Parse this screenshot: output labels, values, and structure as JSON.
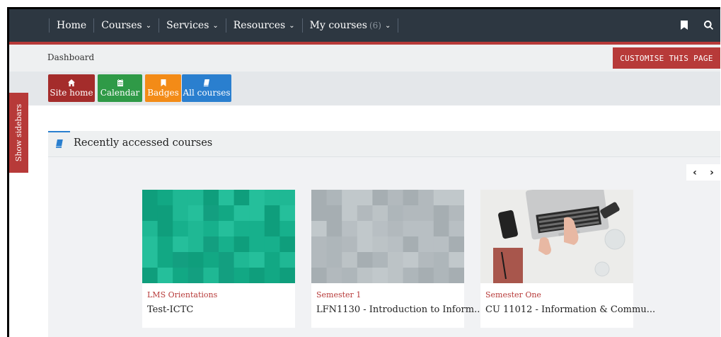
{
  "navbar": {
    "items": [
      {
        "label": "Home",
        "dropdown": false
      },
      {
        "label": "Courses",
        "dropdown": true
      },
      {
        "label": "Services",
        "dropdown": true
      },
      {
        "label": "Resources",
        "dropdown": true
      },
      {
        "label": "My courses",
        "count": "(6)",
        "dropdown": true
      }
    ],
    "right_icons": [
      "bookmark-icon",
      "search-icon"
    ]
  },
  "header": {
    "breadcrumb": "Dashboard",
    "customise_label": "CUSTOMISE THIS PAGE"
  },
  "quick_links": [
    {
      "label": "Site home",
      "icon": "home-icon",
      "color": "#a42c2b"
    },
    {
      "label": "Calendar",
      "icon": "calendar-icon",
      "color": "#2f9a47"
    },
    {
      "label": "Badges",
      "icon": "bookmark-icon",
      "color": "#f38b17"
    },
    {
      "label": "All courses",
      "icon": "book-icon",
      "color": "#2a7fcf"
    }
  ],
  "sidebar_tab": {
    "label": "Show sidebars"
  },
  "block": {
    "title": "Recently accessed courses",
    "pager": {
      "prev": "‹",
      "next": "›"
    },
    "courses": [
      {
        "category": "LMS Orientations",
        "name": "Test-ICTC",
        "thumb": "teal-pattern"
      },
      {
        "category": "Semester 1",
        "name": "LFN1130 - Introduction to Inform...",
        "thumb": "grey-pattern"
      },
      {
        "category": "Semester One",
        "name": "CU 11012 - Information & Commu...",
        "thumb": "laptop-photo"
      }
    ]
  },
  "colors": {
    "navbar_bg": "#2d3741",
    "brand_red": "#b73a39",
    "link_blue": "#2a7fcf"
  }
}
